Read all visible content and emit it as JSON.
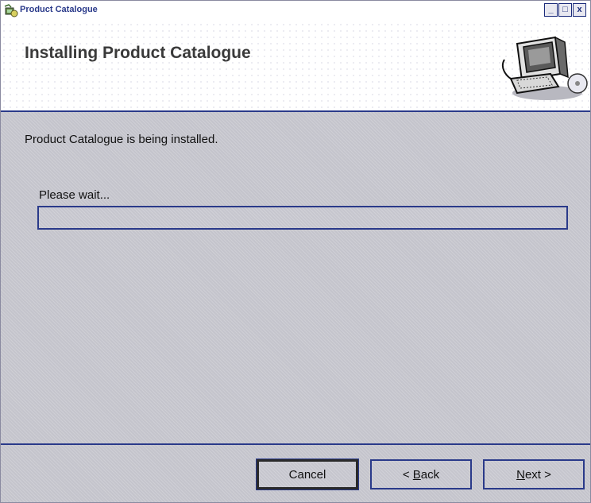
{
  "window": {
    "title": "Product Catalogue",
    "controls": {
      "minimize": "_",
      "maximize": "□",
      "close": "x"
    }
  },
  "header": {
    "title": "Installing Product Catalogue",
    "graphic": "computer-setup-icon"
  },
  "body": {
    "status": "Product Catalogue is being installed.",
    "wait": "Please wait...",
    "progress": 0
  },
  "buttons": {
    "cancel": "Cancel",
    "back_prefix": "< ",
    "back_access": "B",
    "back_rest": "ack",
    "next_access": "N",
    "next_rest": "ext >"
  },
  "colors": {
    "accent": "#2a3a8a",
    "background": "#c4c4cc"
  }
}
